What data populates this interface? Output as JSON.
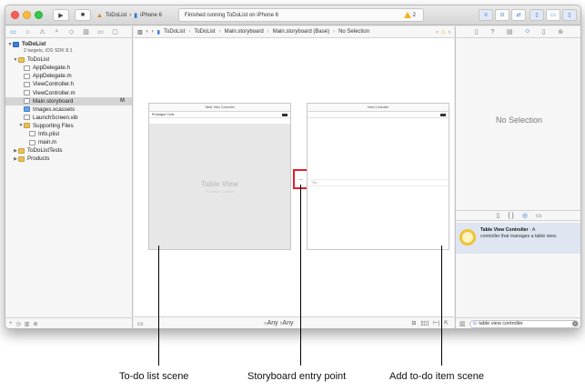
{
  "toolbar": {
    "run_icon": "▶",
    "stop_icon": "■",
    "scheme_app": "ToDoList",
    "scheme_device": "iPhone 6",
    "scheme_sep": "›",
    "scheme_app_icon": "▲",
    "scheme_device_icon": "▮",
    "activity_text": "Finished running ToDoList on iPhone 6",
    "warning_count": "2",
    "editor_mode_icons": [
      "≡",
      "⊙",
      "⇄"
    ],
    "view_mode_icons": [
      "▯",
      "▭",
      "▯"
    ]
  },
  "navigator": {
    "tab_icons": [
      "▭",
      "⌂",
      "⚠",
      "⌕",
      "◇",
      "▥",
      "▭",
      "▢"
    ],
    "project": {
      "name": "ToDoList",
      "subtitle": "2 targets, iOS SDK 8.1"
    },
    "items": [
      {
        "label": "ToDoList",
        "kind": "folder",
        "disclosure": "▼"
      },
      {
        "label": "AppDelegate.h",
        "kind": "file",
        "badge": ""
      },
      {
        "label": "AppDelegate.m",
        "kind": "file",
        "badge": ""
      },
      {
        "label": "ViewController.h",
        "kind": "file",
        "badge": ""
      },
      {
        "label": "ViewController.m",
        "kind": "file",
        "badge": ""
      },
      {
        "label": "Main.storyboard",
        "kind": "file",
        "badge": "M"
      },
      {
        "label": "Images.xcassets",
        "kind": "assets",
        "badge": ""
      },
      {
        "label": "LaunchScreen.xib",
        "kind": "file",
        "badge": ""
      },
      {
        "label": "Supporting Files",
        "kind": "folder",
        "disclosure": "▼"
      },
      {
        "label": "Info.plist",
        "kind": "plist",
        "badge": ""
      },
      {
        "label": "main.m",
        "kind": "file",
        "badge": ""
      },
      {
        "label": "ToDoListTests",
        "kind": "folder",
        "disclosure": "▶"
      },
      {
        "label": "Products",
        "kind": "folder",
        "disclosure": "▶"
      }
    ],
    "filter_icons": [
      "+",
      "◷",
      "▥",
      "⊕"
    ]
  },
  "editor": {
    "jumpbar": {
      "left_icons": [
        "▥",
        "‹",
        "›"
      ],
      "crumbs": [
        "ToDoList",
        "ToDoList",
        "Main.storyboard",
        "Main.storyboard (Base)",
        "No Selection"
      ],
      "sep": "›",
      "right_icons": [
        "‹",
        "⚠",
        "›"
      ]
    },
    "todo_scene": {
      "title": "Table View Controller",
      "prototype_label": "Prototype Cells",
      "table_title": "Table View",
      "table_subtitle": "Prototype Content"
    },
    "add_scene": {
      "title": "View Controller",
      "cell_label": "Title"
    },
    "entry_arrow": "→",
    "size_class": {
      "w": "w",
      "any1": "Any",
      "h": "h",
      "any2": "Any"
    },
    "bottom_left_icon": "▭",
    "bottom_right_icons": [
      "⊟",
      "|◫|",
      "⊢|",
      "⇱"
    ]
  },
  "utilities": {
    "inspector_icons": [
      "▯",
      "?",
      "▤",
      "⬦",
      "▯",
      "⊛"
    ],
    "no_selection": "No Selection",
    "library_tabs": [
      "▯",
      "{ }",
      "◎",
      "▭"
    ],
    "library_item": {
      "name": "Table View Controller",
      "desc_1": "- A",
      "desc_2": "controller that manages a table view."
    },
    "filter_value": "table view controller",
    "filter_icon": "⊙",
    "grid_icon": "▥",
    "clear_icon": "×"
  },
  "callouts": {
    "todo_list_scene": "To-do list scene",
    "entry_point": "Storyboard entry point",
    "add_item_scene": "Add to-do item scene"
  },
  "colors": {
    "accent": "#2a72d8",
    "highlight": "#e3202e",
    "warning": "#f2b31c"
  }
}
